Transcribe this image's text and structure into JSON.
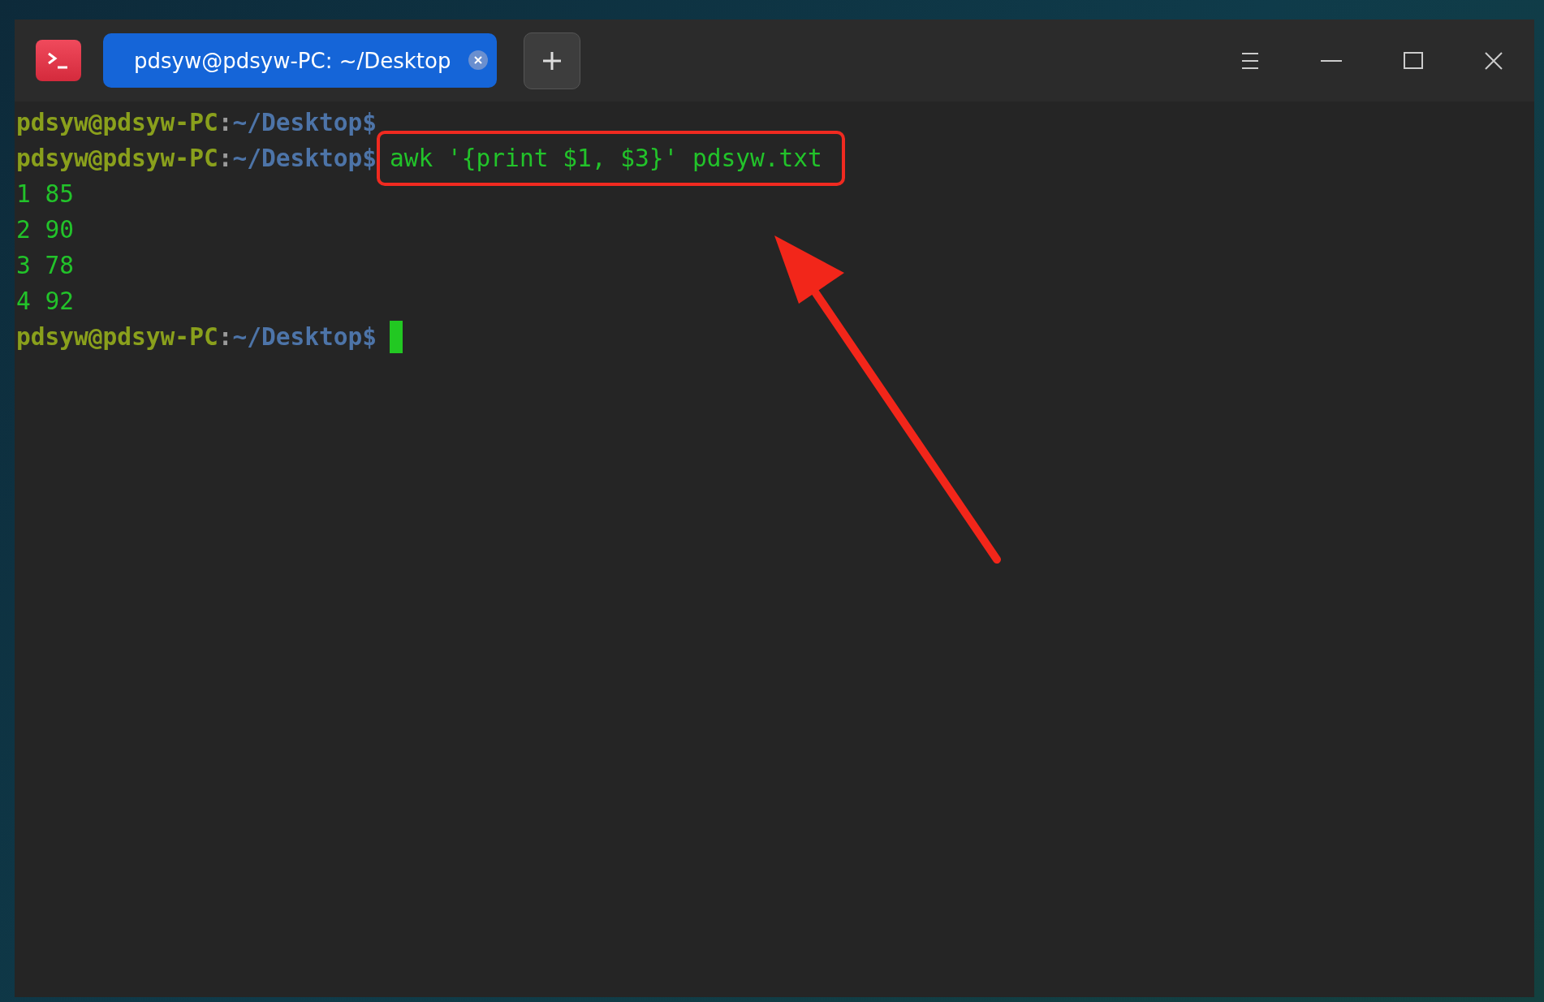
{
  "tab": {
    "title": "pdsyw@pdsyw-PC: ~/Desktop",
    "selected": true
  },
  "terminal_lines": [
    {
      "kind": "prompt",
      "user_host": "pdsyw@pdsyw-PC",
      "separator": ":",
      "path": "~/Desktop$",
      "cursor": false
    },
    {
      "kind": "prompt",
      "user_host": "pdsyw@pdsyw-PC",
      "separator": ":",
      "path": "~/Desktop$",
      "command": "awk '{print $1, $3}' pdsyw.txt",
      "highlighted": true,
      "cursor": false
    },
    {
      "kind": "output",
      "text": "1 85"
    },
    {
      "kind": "output",
      "text": "2 90"
    },
    {
      "kind": "output",
      "text": "3 78"
    },
    {
      "kind": "output",
      "text": "4 92"
    },
    {
      "kind": "prompt",
      "user_host": "pdsyw@pdsyw-PC",
      "separator": ":",
      "path": "~/Desktop$",
      "cursor": true
    }
  ]
}
